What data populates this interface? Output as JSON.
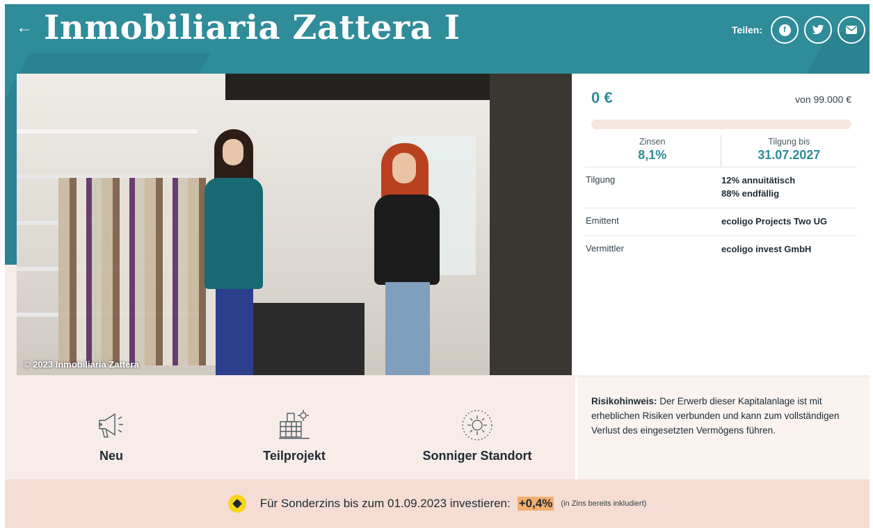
{
  "header": {
    "title": "Inmobiliaria Zattera I",
    "share_label": "Teilen:",
    "share_icons": [
      "facebook-icon",
      "twitter-icon",
      "mail-icon"
    ]
  },
  "photo": {
    "caption": "© 2023 Inmobiliaria Zattera"
  },
  "investment": {
    "amount": "0 €",
    "target": "von 99.000 €",
    "progress_percent": 0,
    "zinsen_label": "Zinsen",
    "zinsen_value": "8,1%",
    "tilgung_bis_label": "Tilgung bis",
    "tilgung_bis_value": "31.07.2027",
    "rows": [
      {
        "key": "Tilgung",
        "value_lines": [
          "12% annuitätisch",
          "88% endfällig"
        ]
      },
      {
        "key": "Emittent",
        "value_lines": [
          "ecoligo Projects Two UG"
        ]
      },
      {
        "key": "Vermittler",
        "value_lines": [
          "ecoligo invest GmbH"
        ]
      }
    ]
  },
  "features": [
    {
      "label": "Neu",
      "icon": "megaphone-icon"
    },
    {
      "label": "Teilprojekt",
      "icon": "solar-building-icon"
    },
    {
      "label": "Sonniger Standort",
      "icon": "sun-icon"
    }
  ],
  "risk": {
    "heading": "Risikohinweis:",
    "text": " Der Erwerb dieser Kapitalanlage ist mit erheblichen Risiken verbunden und kann zum vollständigen Verlust des eingesetzten Vermögens führen."
  },
  "banner": {
    "text": "Für Sonderzins bis zum 01.09.2023 investieren:",
    "bonus": "+0,4%",
    "note": "(in Zins bereits inkludiert)"
  },
  "colors": {
    "brand_teal": "#2f8c99",
    "highlight": "#f3ae6d",
    "tag_yellow": "#f5d51c",
    "page_bg": "#f8ece8"
  }
}
